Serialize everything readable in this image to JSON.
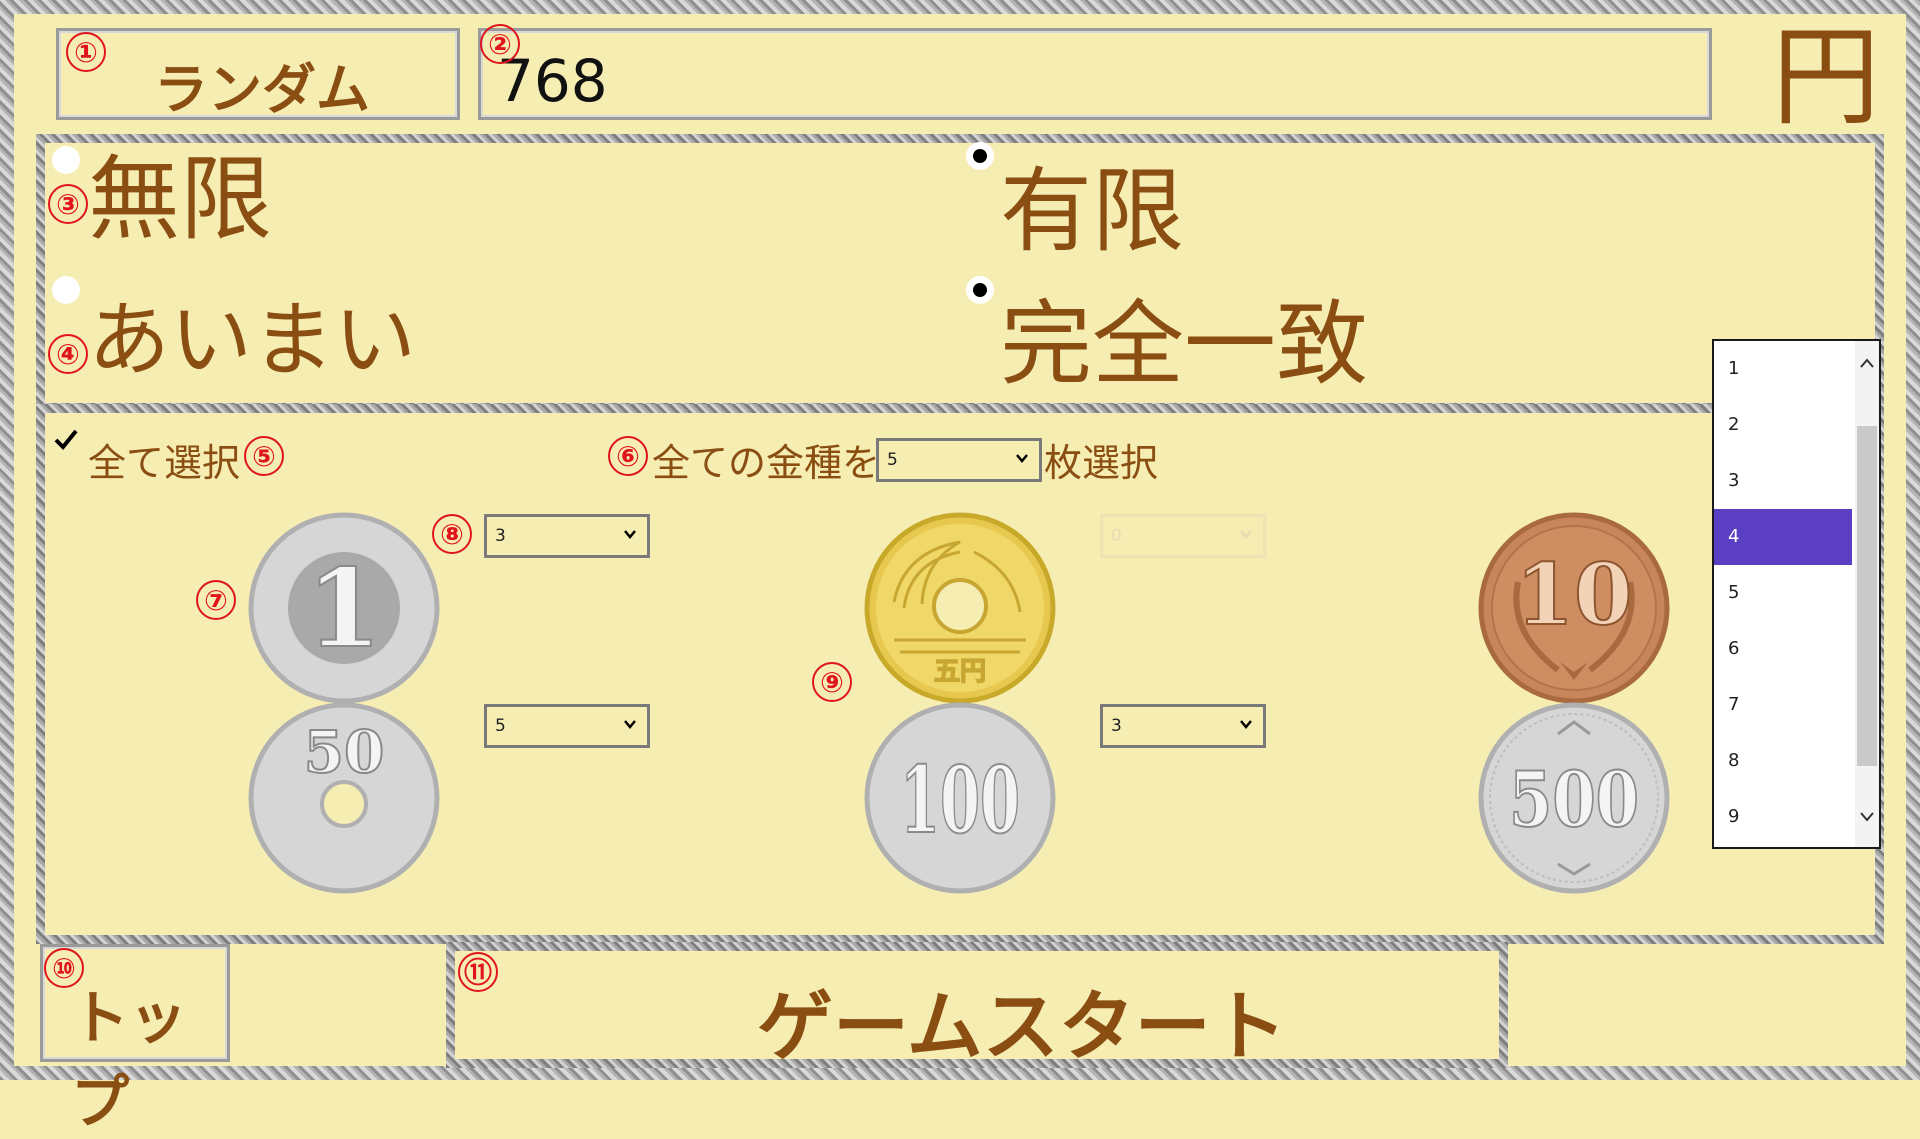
{
  "currency_suffix": "円",
  "top": {
    "random_button": "ランダム",
    "amount_value": "768"
  },
  "markers": [
    "①",
    "②",
    "③",
    "④",
    "⑤",
    "⑥",
    "⑦",
    "⑧",
    "⑨",
    "⑩",
    "⑪"
  ],
  "options": {
    "infinite": "無限",
    "finite": "有限",
    "fuzzy": "あいまい",
    "exact": "完全一致",
    "infinite_selected": false,
    "finite_selected": true,
    "fuzzy_selected": false,
    "exact_selected": true
  },
  "selection": {
    "select_all_label": "全て選択",
    "select_all_checked": true,
    "all_coins_prefix": "全ての金種を",
    "all_coins_value": "5",
    "all_coins_suffix": "枚選択"
  },
  "coins": [
    {
      "name": "1",
      "count": "3",
      "disabled": false
    },
    {
      "name": "5",
      "count": "0",
      "disabled": true
    },
    {
      "name": "10",
      "count": "4",
      "disabled": false
    },
    {
      "name": "50",
      "count": "5",
      "disabled": false
    },
    {
      "name": "100",
      "count": "3",
      "disabled": false
    },
    {
      "name": "500",
      "count": "",
      "disabled": false
    }
  ],
  "coin_faces": {
    "one": "1",
    "five": "五円",
    "ten": "10",
    "fifty": "50",
    "hundred": "100",
    "five_hundred": "500"
  },
  "dropdown": {
    "items": [
      "1",
      "2",
      "3",
      "4",
      "5",
      "6",
      "7",
      "8",
      "9"
    ],
    "selected": "4"
  },
  "bottom": {
    "top_button": "トップ",
    "start_button": "ゲームスタート"
  },
  "colors": {
    "background": "#f6edb3",
    "text_brown": "#8a4e12",
    "marker_red": "#e0141c",
    "dropdown_selected": "#5b3fc2"
  }
}
